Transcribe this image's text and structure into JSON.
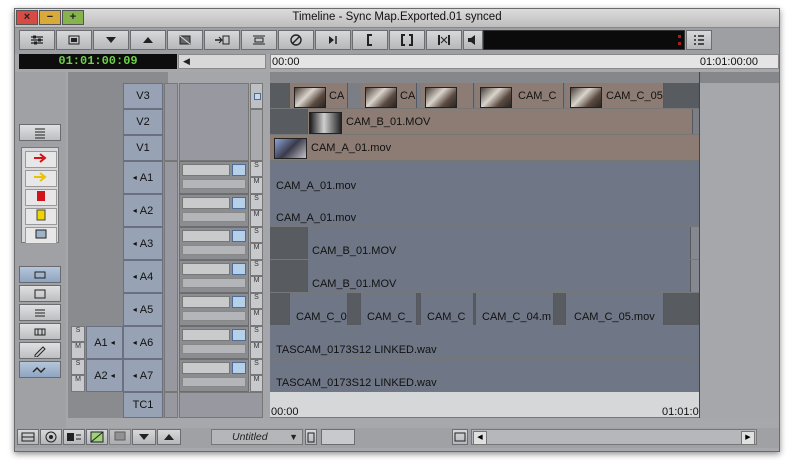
{
  "window": {
    "title": "Timeline - Sync Map.Exported.01 synced"
  },
  "controls": {
    "close": "×",
    "minimize": "−",
    "maximize": "+"
  },
  "timecode": {
    "current": "01:01:00:09"
  },
  "ruler": {
    "start": "00:00",
    "end": "01:01:00:00"
  },
  "tc1_ruler": {
    "start": "00:00",
    "end": "01:01:0"
  },
  "tracks": [
    {
      "name": "V3"
    },
    {
      "name": "V2"
    },
    {
      "name": "V1"
    },
    {
      "name": "A1"
    },
    {
      "name": "A2"
    },
    {
      "name": "A3"
    },
    {
      "name": "A4"
    },
    {
      "name": "A5"
    },
    {
      "name": "A6"
    },
    {
      "name": "A7"
    },
    {
      "name": "TC1"
    }
  ],
  "source_tracks": [
    {
      "name": "A1"
    },
    {
      "name": "A2"
    }
  ],
  "clips": {
    "v3": [
      "CA",
      "CA",
      "",
      "CAM_C",
      "CAM_C_05"
    ],
    "v2": "CAM_B_01.MOV",
    "v1": "CAM_A_01.mov",
    "a1": "CAM_A_01.mov",
    "a2": "CAM_A_01.mov",
    "a3": "CAM_B_01.MOV",
    "a4": "CAM_B_01.MOV",
    "a5": [
      "CAM_C_0",
      "CAM_C_",
      "CAM_C",
      "CAM_C_04.m",
      "CAM_C_05.mov"
    ],
    "a6": "TASCAM_0173S12 LINKED.wav",
    "a7": "TASCAM_0173S12 LINKED.wav"
  },
  "bottom": {
    "bin_name": "Untitled"
  },
  "sm": {
    "s": "S",
    "m": "M"
  }
}
